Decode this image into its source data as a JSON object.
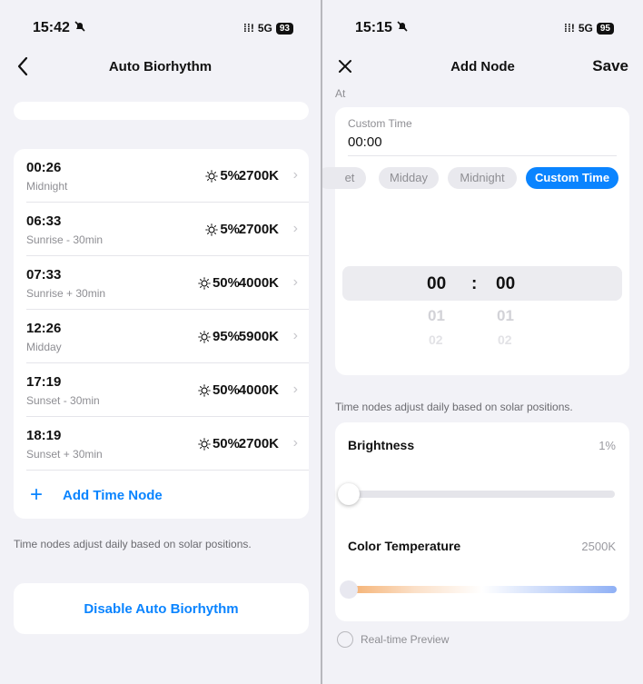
{
  "left": {
    "status": {
      "time": "15:42",
      "network": "5G",
      "battery": "93"
    },
    "title": "Auto Biorhythm",
    "nodes": [
      {
        "time": "00:26",
        "label": "Midnight",
        "brightness": "5%",
        "kelvin": "2700K"
      },
      {
        "time": "06:33",
        "label": "Sunrise - 30min",
        "brightness": "5%",
        "kelvin": "2700K"
      },
      {
        "time": "07:33",
        "label": "Sunrise + 30min",
        "brightness": "50%",
        "kelvin": "4000K"
      },
      {
        "time": "12:26",
        "label": "Midday",
        "brightness": "95%",
        "kelvin": "5900K"
      },
      {
        "time": "17:19",
        "label": "Sunset - 30min",
        "brightness": "50%",
        "kelvin": "4000K"
      },
      {
        "time": "18:19",
        "label": "Sunset + 30min",
        "brightness": "50%",
        "kelvin": "2700K"
      }
    ],
    "add_label": "Add Time Node",
    "hint": "Time nodes adjust daily based on solar positions.",
    "disable_label": "Disable Auto Biorhythm"
  },
  "right": {
    "status": {
      "time": "15:15",
      "network": "5G",
      "battery": "95"
    },
    "title": "Add Node",
    "save_label": "Save",
    "at_label": "At",
    "custom_time_label": "Custom Time",
    "custom_time_value": "00:00",
    "chips": [
      "et",
      "Midday",
      "Midnight",
      "Custom Time"
    ],
    "wheel": {
      "hour": "00",
      "sep": ":",
      "minute": "00",
      "hour_next": "01",
      "minute_next": "01",
      "hour_next2": "02",
      "minute_next2": "02"
    },
    "hint": "Time nodes adjust daily based on solar positions.",
    "brightness_label": "Brightness",
    "brightness_value": "1%",
    "brightness_level": 0.01,
    "color_temp_label": "Color Temperature",
    "color_temp_value": "2500K",
    "preview_label": "Real-time Preview",
    "accent": "#0a84ff"
  },
  "icons": {
    "back": "chevron-left",
    "close": "x",
    "chevron": "chevron-right",
    "sun": "sun",
    "plus": "plus",
    "mute": "bell-slash",
    "signal": "signal-bars"
  }
}
